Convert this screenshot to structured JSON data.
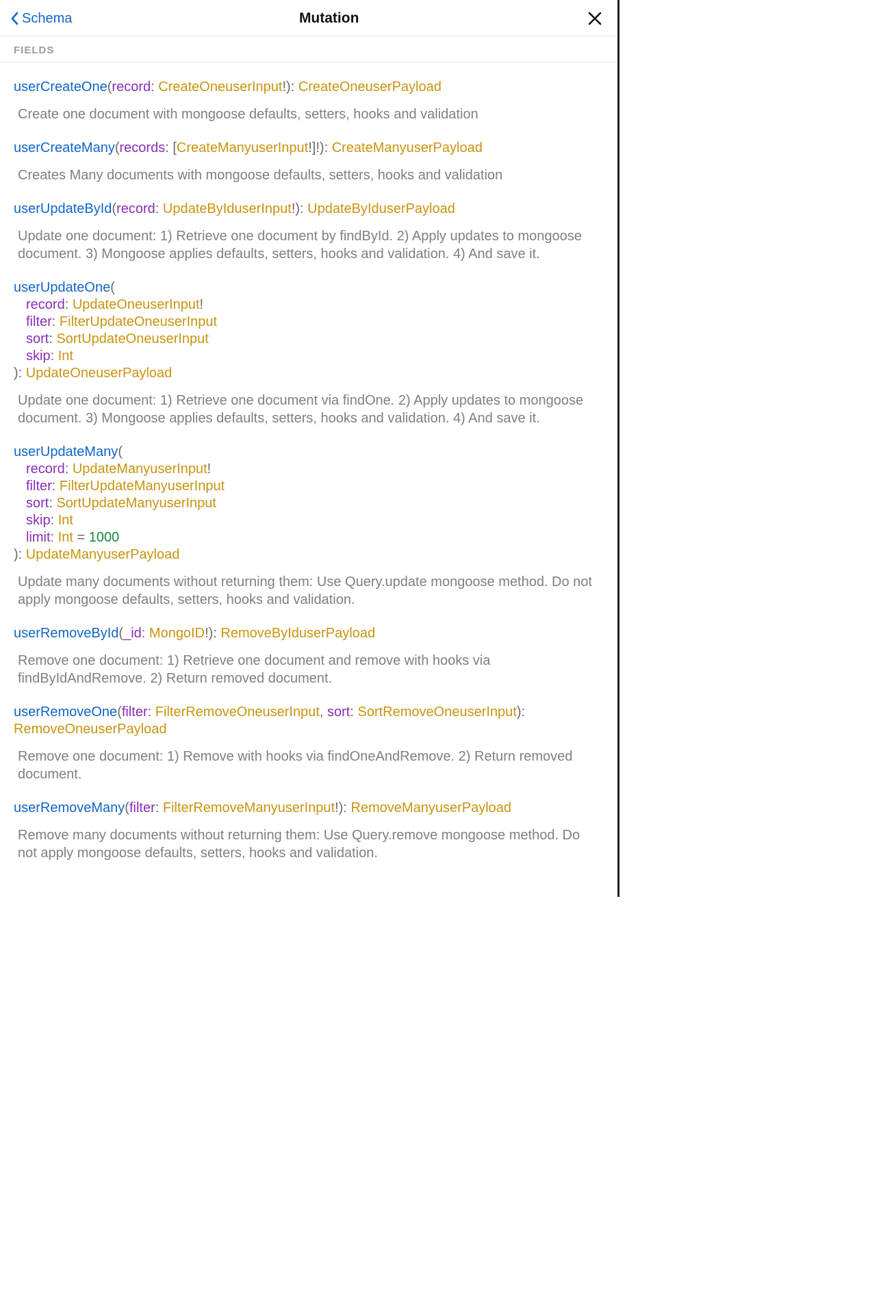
{
  "header": {
    "back_label": "Schema",
    "title": "Mutation"
  },
  "section_label": "FIELDS",
  "fields": [
    {
      "name": "userCreateOne",
      "return_type": "CreateOneuserPayload",
      "multiline": false,
      "args": [
        {
          "name": "record",
          "type": "CreateOneuserInput",
          "nonnull": true
        }
      ],
      "description": "Create one document with mongoose defaults, setters, hooks and validation"
    },
    {
      "name": "userCreateMany",
      "return_type": "CreateManyuserPayload",
      "multiline": false,
      "args": [
        {
          "name": "records",
          "type": "CreateManyuserInput",
          "list": true,
          "nonnull_inner": true,
          "nonnull": true
        }
      ],
      "description": "Creates Many documents with mongoose defaults, setters, hooks and validation"
    },
    {
      "name": "userUpdateById",
      "return_type": "UpdateByIduserPayload",
      "multiline": false,
      "args": [
        {
          "name": "record",
          "type": "UpdateByIduserInput",
          "nonnull": true
        }
      ],
      "description": "Update one document: 1) Retrieve one document by findById. 2) Apply updates to mongoose document. 3) Mongoose applies defaults, setters, hooks and validation. 4) And save it."
    },
    {
      "name": "userUpdateOne",
      "return_type": "UpdateOneuserPayload",
      "multiline": true,
      "args": [
        {
          "name": "record",
          "type": "UpdateOneuserInput",
          "nonnull": true
        },
        {
          "name": "filter",
          "type": "FilterUpdateOneuserInput"
        },
        {
          "name": "sort",
          "type": "SortUpdateOneuserInput"
        },
        {
          "name": "skip",
          "type": "Int"
        }
      ],
      "description": "Update one document: 1) Retrieve one document via findOne. 2) Apply updates to mongoose document. 3) Mongoose applies defaults, setters, hooks and validation. 4) And save it."
    },
    {
      "name": "userUpdateMany",
      "return_type": "UpdateManyuserPayload",
      "multiline": true,
      "args": [
        {
          "name": "record",
          "type": "UpdateManyuserInput",
          "nonnull": true
        },
        {
          "name": "filter",
          "type": "FilterUpdateManyuserInput"
        },
        {
          "name": "sort",
          "type": "SortUpdateManyuserInput"
        },
        {
          "name": "skip",
          "type": "Int"
        },
        {
          "name": "limit",
          "type": "Int",
          "default": "1000"
        }
      ],
      "description": "Update many documents without returning them: Use Query.update mongoose method. Do not apply mongoose defaults, setters, hooks and validation."
    },
    {
      "name": "userRemoveById",
      "return_type": "RemoveByIduserPayload",
      "multiline": false,
      "args": [
        {
          "name": "_id",
          "type": "MongoID",
          "nonnull": true
        }
      ],
      "description": "Remove one document: 1) Retrieve one document and remove with hooks via findByIdAndRemove. 2) Return removed document."
    },
    {
      "name": "userRemoveOne",
      "return_type": "RemoveOneuserPayload",
      "multiline": false,
      "args": [
        {
          "name": "filter",
          "type": "FilterRemoveOneuserInput"
        },
        {
          "name": "sort",
          "type": "SortRemoveOneuserInput"
        }
      ],
      "description": "Remove one document: 1) Remove with hooks via findOneAndRemove. 2) Return removed document."
    },
    {
      "name": "userRemoveMany",
      "return_type": "RemoveManyuserPayload",
      "multiline": false,
      "args": [
        {
          "name": "filter",
          "type": "FilterRemoveManyuserInput",
          "nonnull": true
        }
      ],
      "description": "Remove many documents without returning them: Use Query.remove mongoose method. Do not apply mongoose defaults, setters, hooks and validation."
    }
  ]
}
